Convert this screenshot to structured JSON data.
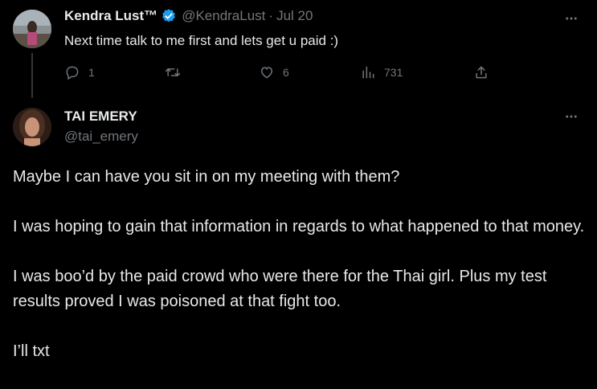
{
  "reply": {
    "name": "Kendra Lust™",
    "handle": "@KendraLust",
    "separator": "·",
    "date": "Jul 20",
    "text": "Next time talk to me first and lets get u paid :)",
    "reply_count": "1",
    "like_count": "6",
    "view_count": "731",
    "icons": [
      "reply-icon",
      "retweet-icon",
      "like-icon",
      "views-icon",
      "share-icon",
      "verified-icon",
      "more-icon"
    ],
    "verified_color": "#1d9bf0"
  },
  "main": {
    "name": "TAI EMERY",
    "handle": "@tai_emery",
    "paragraphs": [
      "Maybe I can have you sit in on my meeting with them?",
      "I was hoping to gain that information in regards to what happened to that money.",
      "I was boo’d by the paid crowd who were there for the Thai girl. Plus my test results proved I was poisoned at that fight too.",
      "I’ll txt"
    ]
  },
  "colors": {
    "background": "#000000",
    "text": "#e7e9ea",
    "muted": "#71767b"
  }
}
